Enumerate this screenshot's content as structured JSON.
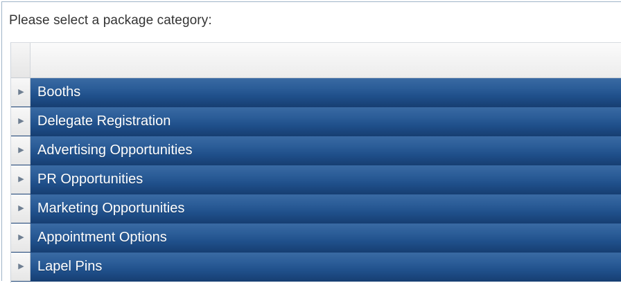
{
  "prompt": "Please select a package category:",
  "grid": {
    "header_label": "",
    "rows": [
      {
        "label": "Booths",
        "icon": "expand-arrow-icon"
      },
      {
        "label": "Delegate Registration",
        "icon": "expand-arrow-icon"
      },
      {
        "label": "Advertising Opportunities",
        "icon": "expand-arrow-icon"
      },
      {
        "label": "PR Opportunities",
        "icon": "expand-arrow-icon"
      },
      {
        "label": "Marketing Opportunities",
        "icon": "expand-arrow-icon"
      },
      {
        "label": "Appointment Options",
        "icon": "expand-arrow-icon"
      },
      {
        "label": "Lapel Pins",
        "icon": "expand-arrow-icon"
      }
    ]
  },
  "colors": {
    "row_blue": "#1f4f8a",
    "row_blue_light": "#3a6aa3",
    "header_bg": "#f2f2f2",
    "prompt_text": "#333333"
  }
}
